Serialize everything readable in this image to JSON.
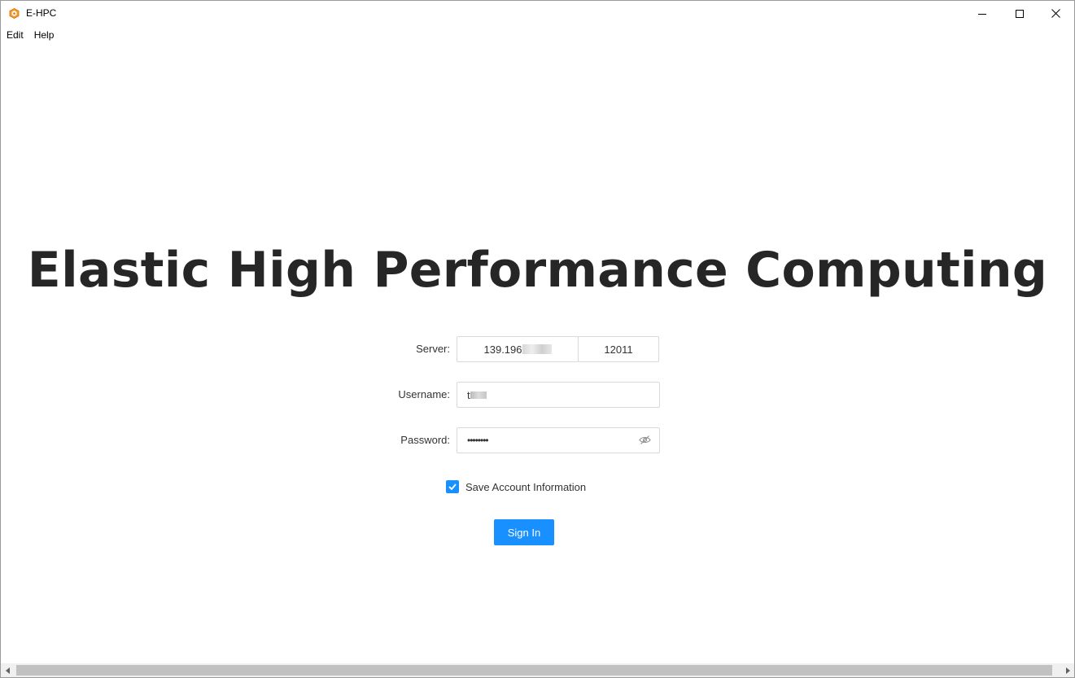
{
  "window": {
    "title": "E-HPC"
  },
  "menubar": {
    "items": [
      "Edit",
      "Help"
    ]
  },
  "main": {
    "heading": "Elastic High Performance Computing"
  },
  "form": {
    "server_label": "Server:",
    "server_ip_visible": "139.196",
    "server_port": "12011",
    "username_label": "Username:",
    "username_visible": "t",
    "password_label": "Password:",
    "password_value": "••••••••",
    "save_account_label": "Save Account Information",
    "save_account_checked": true,
    "sign_in_label": "Sign In"
  },
  "colors": {
    "primary": "#1890ff",
    "heading": "#262626",
    "input_border": "#d9d9d9"
  },
  "icons": {
    "app": "app-logo-icon",
    "minimize": "minimize-icon",
    "maximize": "maximize-icon",
    "close": "close-icon",
    "password_toggle": "eye-hidden-icon",
    "checkbox": "checkmark-icon"
  }
}
